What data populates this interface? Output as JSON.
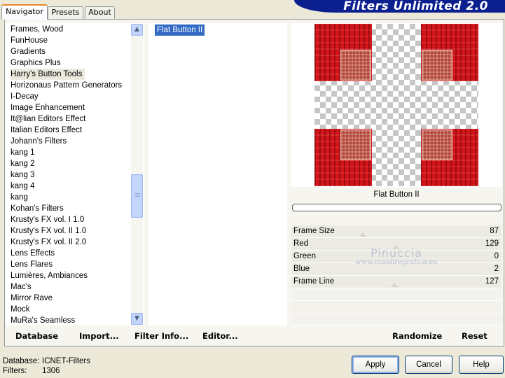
{
  "tabs": [
    {
      "label": "Navigator",
      "active": true
    },
    {
      "label": "Presets",
      "active": false
    },
    {
      "label": "About",
      "active": false
    }
  ],
  "banner": {
    "title": "Filters Unlimited 2.0"
  },
  "categories": [
    "Frames, Wood",
    "FunHouse",
    "Gradients",
    "Graphics Plus",
    "Harry's Button Tools",
    "Horizonaus Pattern Generators",
    "I-Decay",
    "Image Enhancement",
    "It@lian Editors Effect",
    "Italian Editors Effect",
    "Johann's Filters",
    "kang 1",
    "kang 2",
    "kang 3",
    "kang 4",
    "kang",
    "Kohan's Filters",
    "Krusty's FX vol. I 1.0",
    "Krusty's FX vol. II 1.0",
    "Krusty's FX vol. II 2.0",
    "Lens Effects",
    "Lens Flares",
    "Lumières, Ambiances",
    "Mac's",
    "Mirror Rave",
    "Mock",
    "MuRa's Seamless"
  ],
  "selected_category": "Harry's Button Tools",
  "filters": [
    "Flat Button II"
  ],
  "preview": {
    "filter_name": "Flat Button II"
  },
  "params": [
    {
      "label": "Frame Size",
      "value": "87"
    },
    {
      "label": "Red",
      "value": "129"
    },
    {
      "label": "Green",
      "value": "0"
    },
    {
      "label": "Blue",
      "value": "2"
    },
    {
      "label": "Frame Line",
      "value": "127"
    }
  ],
  "watermark": {
    "line1": "Pinuccia",
    "line2": "www.maidiregrafica.eu"
  },
  "links": {
    "database": "Database",
    "import": "Import...",
    "filter_info": "Filter Info...",
    "editor": "Editor...",
    "randomize": "Randomize",
    "reset": "Reset"
  },
  "status": {
    "database_label": "Database:",
    "database_value": "ICNET-Filters",
    "filters_label": "Filters:",
    "filters_value": "1306"
  },
  "buttons": {
    "apply": "Apply",
    "cancel": "Cancel",
    "help": "Help"
  },
  "icons": {
    "scroll_up": "chevron-up-icon",
    "scroll_down": "chevron-down-icon",
    "grip": "grip-icon"
  }
}
